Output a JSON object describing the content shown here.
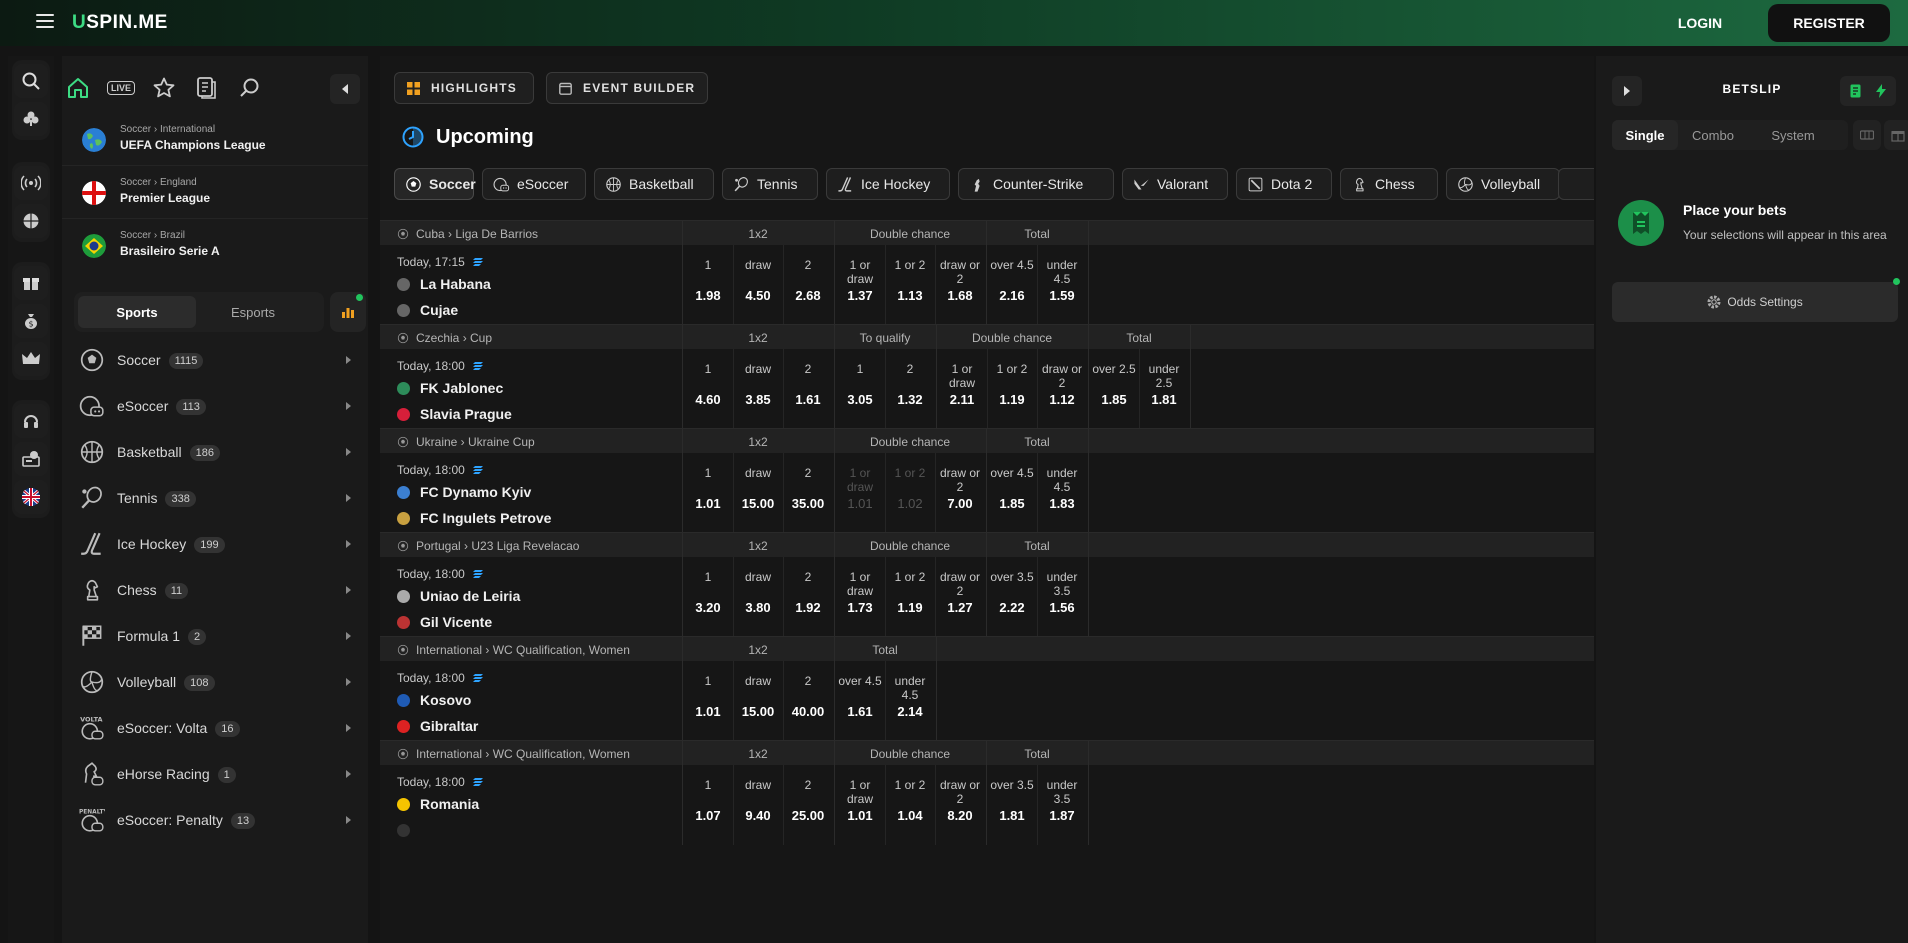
{
  "header": {
    "logo_u": "U",
    "logo_rest": "SPIN.ME",
    "login_label": "LOGIN",
    "register_label": "REGISTER"
  },
  "sidebar": {
    "live_label": "LIVE",
    "leagues": [
      {
        "crumb": "Soccer › International",
        "name": "UEFA Champions League"
      },
      {
        "crumb": "Soccer › England",
        "name": "Premier League"
      },
      {
        "crumb": "Soccer › Brazil",
        "name": "Brasileiro Serie A"
      }
    ],
    "tabs": [
      "Sports",
      "Esports"
    ],
    "sports": [
      {
        "name": "Soccer",
        "count": "1115",
        "icon": "soccer-icon"
      },
      {
        "name": "eSoccer",
        "count": "113",
        "icon": "esoccer-icon"
      },
      {
        "name": "Basketball",
        "count": "186",
        "icon": "basketball-icon"
      },
      {
        "name": "Tennis",
        "count": "338",
        "icon": "tennis-icon"
      },
      {
        "name": "Ice Hockey",
        "count": "199",
        "icon": "ice-hockey-icon"
      },
      {
        "name": "Chess",
        "count": "11",
        "icon": "chess-icon"
      },
      {
        "name": "Formula 1",
        "count": "2",
        "icon": "formula-1-icon"
      },
      {
        "name": "Volleyball",
        "count": "108",
        "icon": "volleyball-icon"
      },
      {
        "name": "eSoccer: Volta",
        "count": "16",
        "icon": "esoccer-volta-icon"
      },
      {
        "name": "eHorse Racing",
        "count": "1",
        "icon": "ehorse-racing-icon"
      },
      {
        "name": "eSoccer: Penalty",
        "count": "13",
        "icon": "esoccer-penalty-icon"
      }
    ]
  },
  "main": {
    "highlights_label": "HIGHLIGHTS",
    "event_builder_label": "EVENT BUILDER",
    "title": "Upcoming",
    "chips": [
      "Soccer",
      "eSoccer",
      "Basketball",
      "Tennis",
      "Ice Hockey",
      "Counter-Strike",
      "Valorant",
      "Dota 2",
      "Chess",
      "Volleyball"
    ],
    "events": [
      {
        "loc": "Cuba › Liga De Barrios",
        "time": "Today, 17:15",
        "team1": "La Habana",
        "team2": "Cujae",
        "markets": [
          {
            "label": "1x2",
            "odds": [
              [
                "1",
                "1.98"
              ],
              [
                "draw",
                "4.50"
              ],
              [
                "2",
                "2.68"
              ]
            ]
          },
          {
            "label": "Double chance",
            "odds": [
              [
                "1 or draw",
                "1.37"
              ],
              [
                "1 or 2",
                "1.13"
              ],
              [
                "draw or 2",
                "1.68"
              ]
            ]
          },
          {
            "label": "Total",
            "odds": [
              [
                "over 4.5",
                "2.16"
              ],
              [
                "under 4.5",
                "1.59"
              ]
            ]
          }
        ]
      },
      {
        "loc": "Czechia › Cup",
        "time": "Today, 18:00",
        "team1": "FK Jablonec",
        "team2": "Slavia Prague",
        "markets": [
          {
            "label": "1x2",
            "odds": [
              [
                "1",
                "4.60"
              ],
              [
                "draw",
                "3.85"
              ],
              [
                "2",
                "1.61"
              ]
            ]
          },
          {
            "label": "To qualify",
            "odds": [
              [
                "1",
                "3.05"
              ],
              [
                "2",
                "1.32"
              ]
            ]
          },
          {
            "label": "Double chance",
            "odds": [
              [
                "1 or draw",
                "2.11"
              ],
              [
                "1 or 2",
                "1.19"
              ],
              [
                "draw or 2",
                "1.12"
              ]
            ]
          },
          {
            "label": "Total",
            "odds": [
              [
                "over 2.5",
                "1.85"
              ],
              [
                "under 2.5",
                "1.81"
              ]
            ]
          }
        ]
      },
      {
        "loc": "Ukraine › Ukraine Cup",
        "time": "Today, 18:00",
        "team1": "FC Dynamo Kyiv",
        "team2": "FC Ingulets Petrove",
        "markets": [
          {
            "label": "1x2",
            "odds": [
              [
                "1",
                "1.01"
              ],
              [
                "draw",
                "15.00"
              ],
              [
                "2",
                "35.00"
              ]
            ]
          },
          {
            "label": "Double chance",
            "odds": [
              [
                "1 or draw",
                "1.01"
              ],
              [
                "1 or 2",
                "1.02"
              ],
              [
                "draw or 2",
                "7.00"
              ]
            ]
          },
          {
            "label": "Total",
            "odds": [
              [
                "over 4.5",
                "1.85"
              ],
              [
                "under 4.5",
                "1.83"
              ]
            ]
          }
        ]
      },
      {
        "loc": "Portugal › U23 Liga Revelacao",
        "time": "Today, 18:00",
        "team1": "Uniao de Leiria",
        "team2": "Gil Vicente",
        "markets": [
          {
            "label": "1x2",
            "odds": [
              [
                "1",
                "3.20"
              ],
              [
                "draw",
                "3.80"
              ],
              [
                "2",
                "1.92"
              ]
            ]
          },
          {
            "label": "Double chance",
            "odds": [
              [
                "1 or draw",
                "1.73"
              ],
              [
                "1 or 2",
                "1.19"
              ],
              [
                "draw or 2",
                "1.27"
              ]
            ]
          },
          {
            "label": "Total",
            "odds": [
              [
                "over 3.5",
                "2.22"
              ],
              [
                "under 3.5",
                "1.56"
              ]
            ]
          }
        ]
      },
      {
        "loc": "International › WC Qualification, Women",
        "time": "Today, 18:00",
        "team1": "Kosovo",
        "team2": "Gibraltar",
        "markets": [
          {
            "label": "1x2",
            "odds": [
              [
                "1",
                "1.01"
              ],
              [
                "draw",
                "15.00"
              ],
              [
                "2",
                "40.00"
              ]
            ]
          },
          {
            "label": "Total",
            "odds": [
              [
                "over 4.5",
                "1.61"
              ],
              [
                "under 4.5",
                "2.14"
              ]
            ]
          }
        ]
      },
      {
        "loc": "International › WC Qualification, Women",
        "time": "Today, 18:00",
        "team1": "Romania",
        "team2": "",
        "markets": [
          {
            "label": "1x2",
            "odds": [
              [
                "1",
                "1.07"
              ],
              [
                "draw",
                "9.40"
              ],
              [
                "2",
                "25.00"
              ]
            ]
          },
          {
            "label": "Double chance",
            "odds": [
              [
                "1 or draw",
                "1.01"
              ],
              [
                "1 or 2",
                "1.04"
              ],
              [
                "draw or 2",
                "8.20"
              ]
            ]
          },
          {
            "label": "Total",
            "odds": [
              [
                "over 3.5",
                "1.81"
              ],
              [
                "under 3.5",
                "1.87"
              ]
            ]
          }
        ]
      }
    ]
  },
  "betslip": {
    "title": "BETSLIP",
    "tabs": [
      "Single",
      "Combo",
      "System"
    ],
    "empty_title": "Place your bets",
    "empty_sub": "Your selections will appear in this area",
    "odds_settings_label": "Odds Settings"
  },
  "colors": {
    "accent_green": "#21c45d",
    "dim_odd": "#555555",
    "live_blue": "#2ea3ff"
  }
}
